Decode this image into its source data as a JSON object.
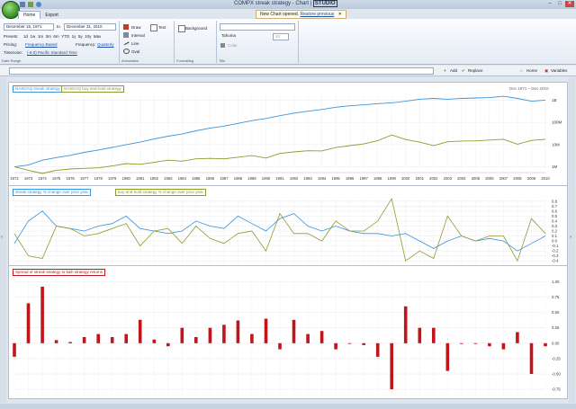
{
  "window": {
    "title": "COMPX streak strategy - Chart | ",
    "brand": "STUDIO",
    "controls": [
      "–",
      "□",
      "✕"
    ]
  },
  "notification": {
    "text": "New Chart opened.",
    "link": "Restore previous"
  },
  "tabs": [
    {
      "label": "Home",
      "active": true
    },
    {
      "label": "Export",
      "active": false
    }
  ],
  "ribbon": {
    "date_range": {
      "from": "December 15, 1971",
      "to_word": "to",
      "to": "December 31, 2010",
      "presets_label": "Presets:",
      "presets": [
        "1d",
        "1w",
        "1m",
        "3m",
        "6m",
        "YTD",
        "1y",
        "5y",
        "10y",
        "Max"
      ],
      "pricing_label": "Pricing:",
      "pricing_value": "Frequency-Based",
      "frequency_label": "Frequency:",
      "frequency_value": "Quarterly",
      "timezone_label": "Timezone:",
      "timezone_value": "(-8.0) Pacific Standard Time",
      "group_label": "Date Range"
    },
    "annotation": {
      "items": [
        "Draw",
        "Interval",
        "Line",
        "Oval"
      ],
      "text_label": "Text",
      "group_label": "Annotation"
    },
    "formatting": {
      "background_label": "Background",
      "group_label": "Formatting"
    },
    "title": {
      "font": "Tahoma",
      "size": "10",
      "color_label": "Color",
      "group_label": "Title"
    }
  },
  "addressbar": {
    "add_label": "Add",
    "replace_label": "Replace",
    "home_label": "Home",
    "variables_label": "Variables"
  },
  "panels": {
    "top": {
      "legend1": "NASDAQ streak strategy",
      "legend2": "NASDAQ buy-and-hold strategy",
      "range": "Dec 1971  –  Dec 2010",
      "y_ticks": [
        {
          "label": "1B",
          "v": 1000000000
        },
        {
          "label": "100M",
          "v": 100000000
        },
        {
          "label": "10M",
          "v": 10000000
        },
        {
          "label": "1M",
          "v": 1000000
        }
      ]
    },
    "mid": {
      "legend1": "streak strategy % change over prior year",
      "legend2": "buy-and-hold strategy % change over prior year",
      "y_ticks": [
        "0.8",
        "0.7",
        "0.6",
        "0.5",
        "0.4",
        "0.3",
        "0.2",
        "0.1",
        "0.0",
        "-0.1",
        "-0.2",
        "-0.3",
        "-0.4"
      ]
    },
    "bot": {
      "legend1": "Spread of streak strategy to b&h strategy returns",
      "y_ticks": [
        "1.00",
        "0.75",
        "0.50",
        "0.25",
        "0.00",
        "-0.25",
        "-0.50",
        "-0.75"
      ]
    }
  },
  "years": [
    "1972",
    "1973",
    "1974",
    "1975",
    "1976",
    "1977",
    "1978",
    "1979",
    "1980",
    "1981",
    "1982",
    "1983",
    "1984",
    "1985",
    "1986",
    "1987",
    "1988",
    "1989",
    "1990",
    "1991",
    "1992",
    "1993",
    "1994",
    "1995",
    "1996",
    "1997",
    "1998",
    "1999",
    "2000",
    "2001",
    "2002",
    "2003",
    "2004",
    "2005",
    "2006",
    "2007",
    "2008",
    "2009",
    "2010"
  ],
  "colors": {
    "streak": "#3b93d9",
    "buyhold": "#8a9b2e",
    "bars": "#c0161b"
  },
  "chart_data": [
    {
      "type": "line",
      "x": [
        1972,
        1973,
        1974,
        1975,
        1976,
        1977,
        1978,
        1979,
        1980,
        1981,
        1982,
        1983,
        1984,
        1985,
        1986,
        1987,
        1988,
        1989,
        1990,
        1991,
        1992,
        1993,
        1994,
        1995,
        1996,
        1997,
        1998,
        1999,
        2000,
        2001,
        2002,
        2003,
        2004,
        2005,
        2006,
        2007,
        2008,
        2009,
        2010
      ],
      "series": [
        {
          "name": "NASDAQ streak strategy",
          "values": [
            1000000,
            1200000,
            2000000,
            2600000,
            3300000,
            4500000,
            5700000,
            7500000,
            10000000,
            13000000,
            18000000,
            24000000,
            30000000,
            42000000,
            55000000,
            68000000,
            90000000,
            120000000,
            150000000,
            200000000,
            260000000,
            320000000,
            380000000,
            480000000,
            560000000,
            620000000,
            700000000,
            760000000,
            900000000,
            1100000000,
            1200000000,
            1100000000,
            1200000000,
            1250000000,
            1300000000,
            1500000000,
            1200000000,
            900000000,
            1000000000
          ]
        },
        {
          "name": "NASDAQ buy-and-hold strategy",
          "values": [
            1000000,
            700000,
            500000,
            700000,
            800000,
            850000,
            900000,
            1100000,
            1400000,
            1300000,
            1600000,
            2000000,
            1800000,
            2300000,
            2400000,
            2300000,
            2700000,
            3200000,
            2500000,
            4000000,
            4700000,
            5300000,
            5200000,
            7400000,
            9000000,
            10800000,
            15000000,
            27000000,
            17000000,
            13000000,
            9000000,
            13500000,
            14500000,
            14700000,
            16000000,
            17500000,
            10500000,
            15500000,
            17500000
          ]
        }
      ],
      "ylabel": "",
      "xlabel": "",
      "scale": "log",
      "ylim": [
        800000,
        2000000000
      ]
    },
    {
      "type": "line",
      "x": [
        1972,
        1973,
        1974,
        1975,
        1976,
        1977,
        1978,
        1979,
        1980,
        1981,
        1982,
        1983,
        1984,
        1985,
        1986,
        1987,
        1988,
        1989,
        1990,
        1991,
        1992,
        1993,
        1994,
        1995,
        1996,
        1997,
        1998,
        1999,
        2000,
        2001,
        2002,
        2003,
        2004,
        2005,
        2006,
        2007,
        2008,
        2009,
        2010
      ],
      "series": [
        {
          "name": "streak strategy % change over prior year",
          "values": [
            -0.05,
            0.4,
            0.6,
            0.3,
            0.25,
            0.2,
            0.3,
            0.35,
            0.5,
            0.25,
            0.2,
            0.15,
            0.2,
            0.4,
            0.3,
            0.25,
            0.5,
            0.35,
            0.2,
            0.45,
            0.55,
            0.3,
            0.2,
            0.3,
            0.2,
            0.15,
            0.15,
            0.1,
            0.15,
            0.0,
            -0.15,
            0.0,
            0.1,
            0.0,
            0.05,
            0.0,
            -0.2,
            -0.05,
            0.1
          ]
        },
        {
          "name": "buy-and-hold strategy % change over prior year",
          "values": [
            0.15,
            -0.3,
            -0.35,
            0.3,
            0.25,
            0.1,
            0.15,
            0.25,
            0.35,
            -0.1,
            0.2,
            0.25,
            -0.05,
            0.3,
            0.05,
            -0.05,
            0.15,
            0.2,
            -0.2,
            0.55,
            0.15,
            0.15,
            0.0,
            0.4,
            0.2,
            0.2,
            0.4,
            0.85,
            -0.4,
            -0.2,
            -0.35,
            0.5,
            0.1,
            0.0,
            0.1,
            0.1,
            -0.4,
            0.45,
            0.15
          ]
        }
      ],
      "ylim": [
        -0.45,
        0.85
      ]
    },
    {
      "type": "bar",
      "categories": [
        "1972",
        "1973",
        "1974",
        "1975",
        "1976",
        "1977",
        "1978",
        "1979",
        "1980",
        "1981",
        "1982",
        "1983",
        "1984",
        "1985",
        "1986",
        "1987",
        "1988",
        "1989",
        "1990",
        "1991",
        "1992",
        "1993",
        "1994",
        "1995",
        "1996",
        "1997",
        "1998",
        "1999",
        "2000",
        "2001",
        "2002",
        "2003",
        "2004",
        "2005",
        "2006",
        "2007",
        "2008",
        "2009",
        "2010"
      ],
      "values": [
        -0.22,
        0.65,
        0.92,
        0.05,
        0.02,
        0.1,
        0.15,
        0.1,
        0.15,
        0.38,
        0.06,
        -0.05,
        0.25,
        0.1,
        0.25,
        0.3,
        0.37,
        0.15,
        0.4,
        -0.1,
        0.38,
        0.15,
        0.2,
        -0.1,
        0.0,
        -0.03,
        -0.22,
        -0.75,
        0.6,
        0.25,
        0.25,
        -0.45,
        0.0,
        0.0,
        -0.05,
        -0.1,
        0.18,
        -0.5,
        -0.05
      ],
      "name": "Spread of streak strategy to b&h strategy returns",
      "ylim": [
        -0.85,
        1.05
      ]
    }
  ]
}
